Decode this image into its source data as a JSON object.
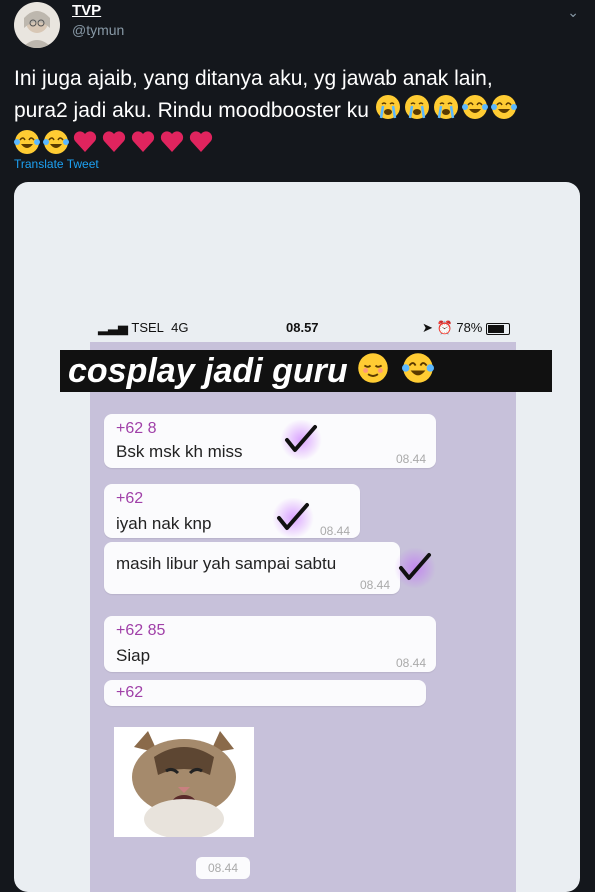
{
  "author": {
    "name": "TVP",
    "handle": "@tymun"
  },
  "tweet": {
    "text_line1": "Ini juga ajaib, yang ditanya aku, yg jawab anak lain,",
    "text_line2": "pura2 jadi aku. Rindu moodbooster ku",
    "translate_label": "Translate Tweet"
  },
  "emojis": [
    "crying-face",
    "crying-face",
    "crying-face",
    "tears-of-joy",
    "tears-of-joy",
    "tears-of-joy",
    "tears-of-joy",
    "red-heart",
    "red-heart",
    "red-heart",
    "red-heart",
    "red-heart"
  ],
  "media": {
    "statusbar": {
      "carrier": "TSEL",
      "network": "4G",
      "time": "08.57",
      "battery": "78%"
    },
    "banner": "cosplay jadi guru",
    "messages": [
      {
        "sender": "+62 8",
        "text": "Bsk msk kh miss",
        "time": "08.44"
      },
      {
        "sender": "+62",
        "text": "iyah nak knp",
        "time": "08.44"
      },
      {
        "sender": "",
        "text": "masih libur yah sampai sabtu",
        "time": "08.44"
      },
      {
        "sender": "+62 85",
        "text": "Siap",
        "time": "08.44"
      },
      {
        "sender": "+62",
        "text": "",
        "time": ""
      }
    ],
    "sticker_time": "08.44"
  },
  "colors": {
    "background": "#14171c",
    "link": "#1da1f2",
    "heart": "#e0245e",
    "sender": "#a040a8"
  }
}
